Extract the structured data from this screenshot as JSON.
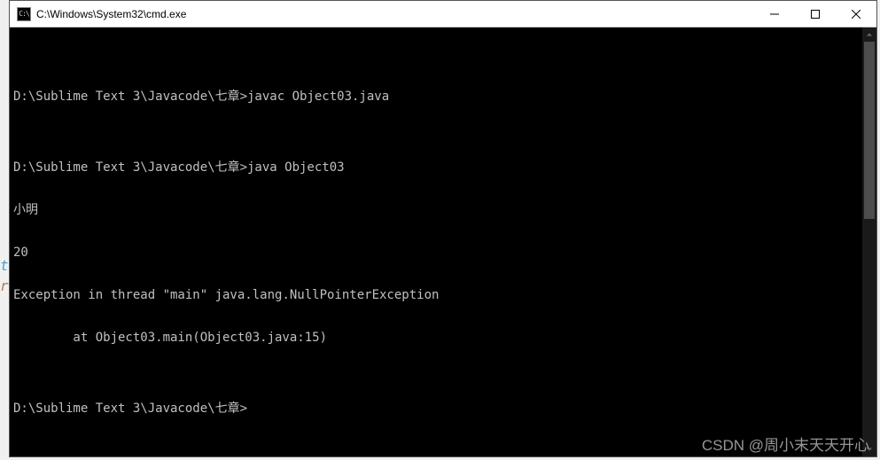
{
  "window": {
    "title": "C:\\Windows\\System32\\cmd.exe",
    "icon_label": "C:\\"
  },
  "terminal": {
    "lines": [
      "",
      "D:\\Sublime Text 3\\Javacode\\七章>javac Object03.java",
      "",
      "D:\\Sublime Text 3\\Javacode\\七章>java Object03",
      "小明",
      "20",
      "Exception in thread \"main\" java.lang.NullPointerException",
      "        at Object03.main(Object03.java:15)",
      "",
      "D:\\Sublime Text 3\\Javacode\\七章>"
    ]
  },
  "side": {
    "t": "t",
    "r": "r"
  },
  "watermark": "CSDN @周小末天天开心"
}
